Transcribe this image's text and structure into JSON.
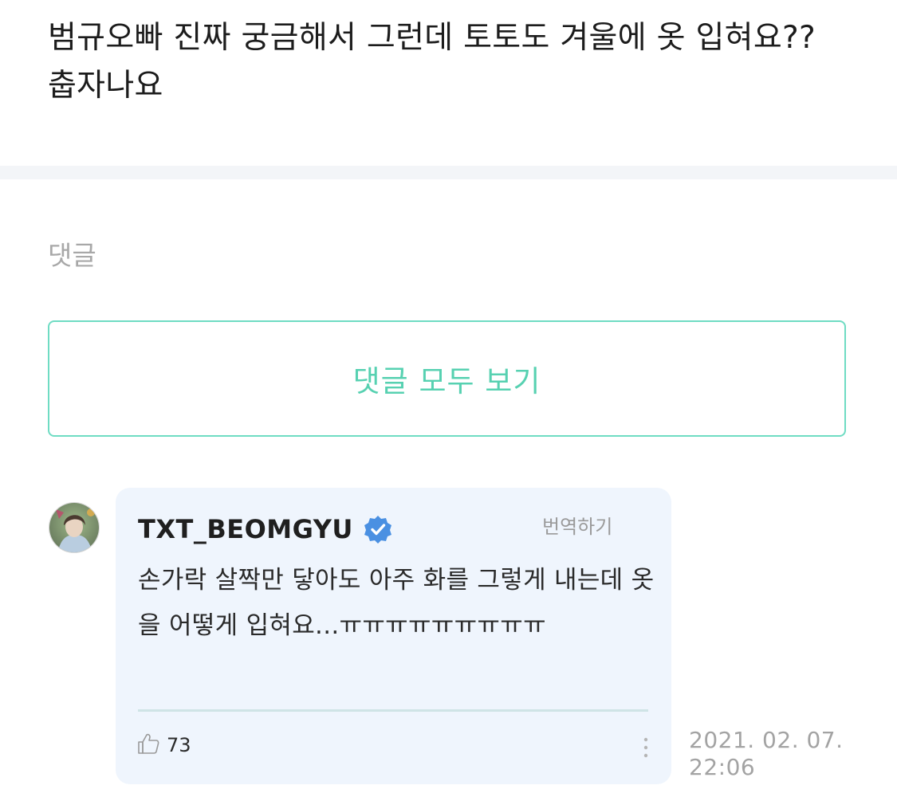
{
  "post": {
    "text": "범규오빠 진짜 궁금해서 그런데 토토도 겨울에 옷 입혀요?? 춥자나요"
  },
  "comments_section": {
    "label": "댓글",
    "view_all_label": "댓글 모두 보기"
  },
  "reply": {
    "avatar_icon": "artist-avatar",
    "author": "TXT_BEOMGYU",
    "verified_icon": "verified-badge-icon",
    "verified_color": "#4a90e2",
    "translate_label": "번역하기",
    "body": "손가락 살짝만 닿아도 아주 화를 그렇게 내는데 옷을 어떻게 입혀요...ㅠㅠㅠㅠㅠㅠㅠㅠㅠ",
    "like_icon": "thumbs-up-icon",
    "like_count": "73",
    "more_icon": "more-vertical-icon",
    "timestamp": "2021. 02. 07. 22:06"
  },
  "colors": {
    "accent": "#57d1b1",
    "card_background": "#eff5fd",
    "divider_band": "#f3f5f8"
  }
}
